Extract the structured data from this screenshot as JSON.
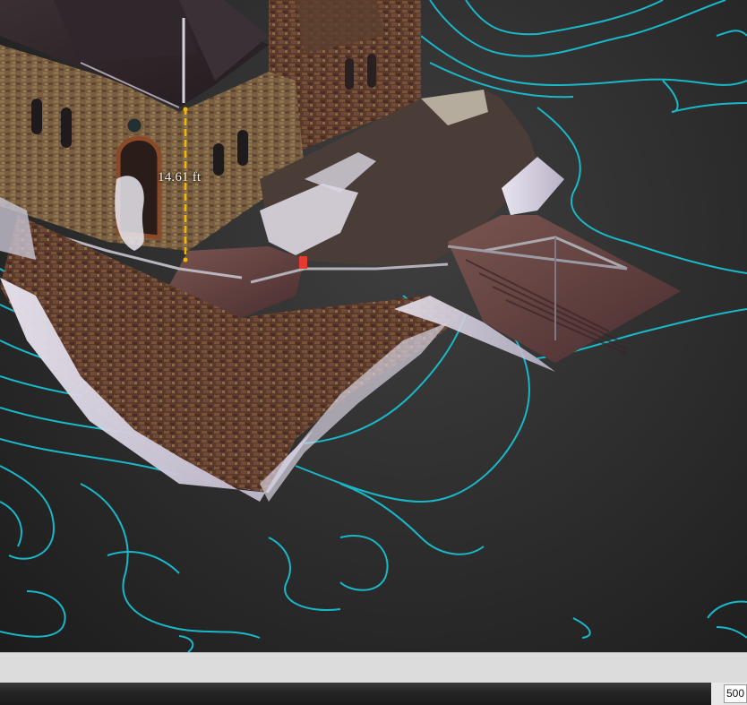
{
  "viewport": {
    "measurement": {
      "label": "14.61 ft",
      "line_color": "#f5b800"
    },
    "contour_color": "#19b8c9",
    "background_color": "#2e2e2e"
  },
  "statusbar": {
    "zoom_value": "500"
  }
}
